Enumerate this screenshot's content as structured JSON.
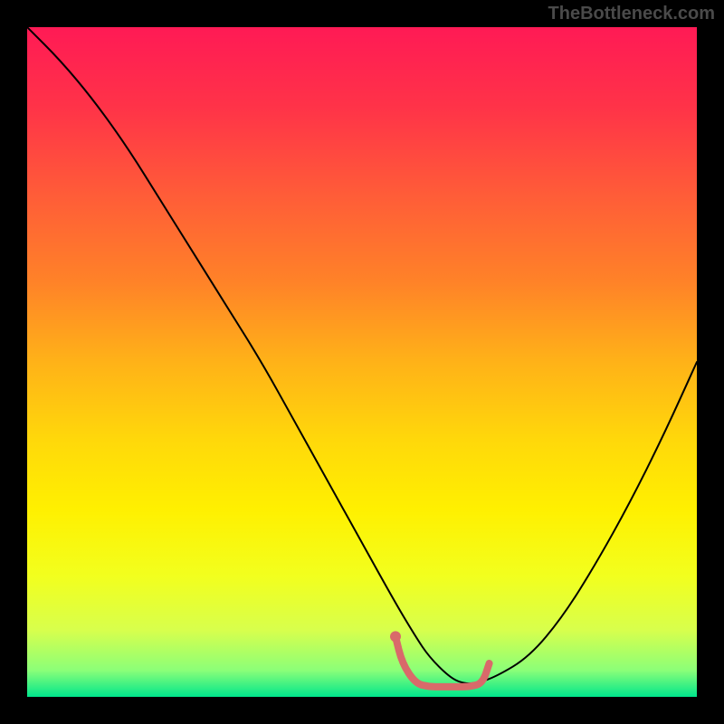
{
  "watermark": "TheBottleneck.com",
  "chart_data": {
    "type": "line",
    "title": "",
    "xlabel": "",
    "ylabel": "",
    "xlim": [
      0,
      100
    ],
    "ylim": [
      0,
      100
    ],
    "series": [
      {
        "name": "bottleneck-curve",
        "stroke": "#000000",
        "stroke_width": 2,
        "x": [
          0,
          5,
          10,
          15,
          20,
          25,
          30,
          35,
          40,
          45,
          50,
          55,
          58,
          60,
          63,
          65,
          67,
          70,
          75,
          80,
          85,
          90,
          95,
          100
        ],
        "y": [
          100,
          95,
          89,
          82,
          74,
          66,
          58,
          50,
          41,
          32,
          23,
          14,
          9,
          6,
          3,
          2,
          2,
          3,
          6,
          12,
          20,
          29,
          39,
          50
        ]
      },
      {
        "name": "optimal-marker",
        "stroke": "#d96a6a",
        "stroke_width": 8,
        "x": [
          55,
          56,
          58,
          60,
          62,
          64,
          66,
          68,
          69
        ],
        "y": [
          9,
          5,
          2,
          1.5,
          1.5,
          1.5,
          1.5,
          2,
          5
        ]
      }
    ],
    "gradient_stops": [
      {
        "offset": 0.0,
        "color": "#ff1a55"
      },
      {
        "offset": 0.12,
        "color": "#ff3348"
      },
      {
        "offset": 0.25,
        "color": "#ff5c38"
      },
      {
        "offset": 0.38,
        "color": "#ff8228"
      },
      {
        "offset": 0.5,
        "color": "#ffb218"
      },
      {
        "offset": 0.62,
        "color": "#ffd90a"
      },
      {
        "offset": 0.72,
        "color": "#fff000"
      },
      {
        "offset": 0.82,
        "color": "#f2ff1e"
      },
      {
        "offset": 0.9,
        "color": "#d8ff4c"
      },
      {
        "offset": 0.96,
        "color": "#8cff78"
      },
      {
        "offset": 1.0,
        "color": "#00e68c"
      }
    ]
  }
}
